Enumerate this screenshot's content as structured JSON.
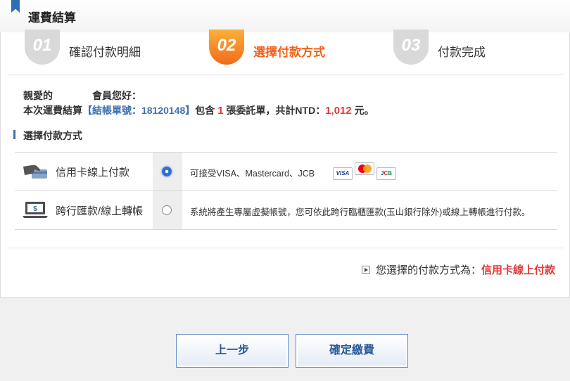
{
  "header": {
    "title": "運費結算"
  },
  "steps": [
    {
      "num": "01",
      "label": "確認付款明細",
      "state": "done"
    },
    {
      "num": "02",
      "label": "選擇付款方式",
      "state": "active"
    },
    {
      "num": "03",
      "label": "付款完成",
      "state": "pending"
    }
  ],
  "greeting": {
    "line1_a": "親愛的",
    "line1_b": "會員您好：",
    "line2_prefix": "本次運費結算",
    "bill_label": "【結帳單號：18120148】",
    "includes": "包含",
    "count": "1",
    "count_suffix": "張委託單，共計NTD：",
    "total": "1,012",
    "currency": "元。"
  },
  "section": {
    "title": "選擇付款方式"
  },
  "payment_methods": [
    {
      "label": "信用卡線上付款",
      "selected": true,
      "desc": "可接受VISA、Mastercard、JCB",
      "cards": [
        "VISA",
        "mastercard",
        "JCB"
      ]
    },
    {
      "label": "跨行匯款/線上轉帳",
      "selected": false,
      "desc": "系統將產生專屬虛擬帳號，您可依此跨行臨櫃匯款(玉山銀行除外)或線上轉帳進行付款。"
    }
  ],
  "summary": {
    "prefix": "您選擇的付款方式為：",
    "value": "信用卡線上付款"
  },
  "buttons": {
    "prev": "上一步",
    "confirm": "確定繳費"
  },
  "colors": {
    "accent": "#3e6fb0",
    "active_step": "#f0621b",
    "highlight": "#e03a3a"
  },
  "icons": {
    "hand": "hand-card-icon",
    "laptop": "laptop-dollar-icon",
    "bookmark": "bookmark-icon"
  }
}
